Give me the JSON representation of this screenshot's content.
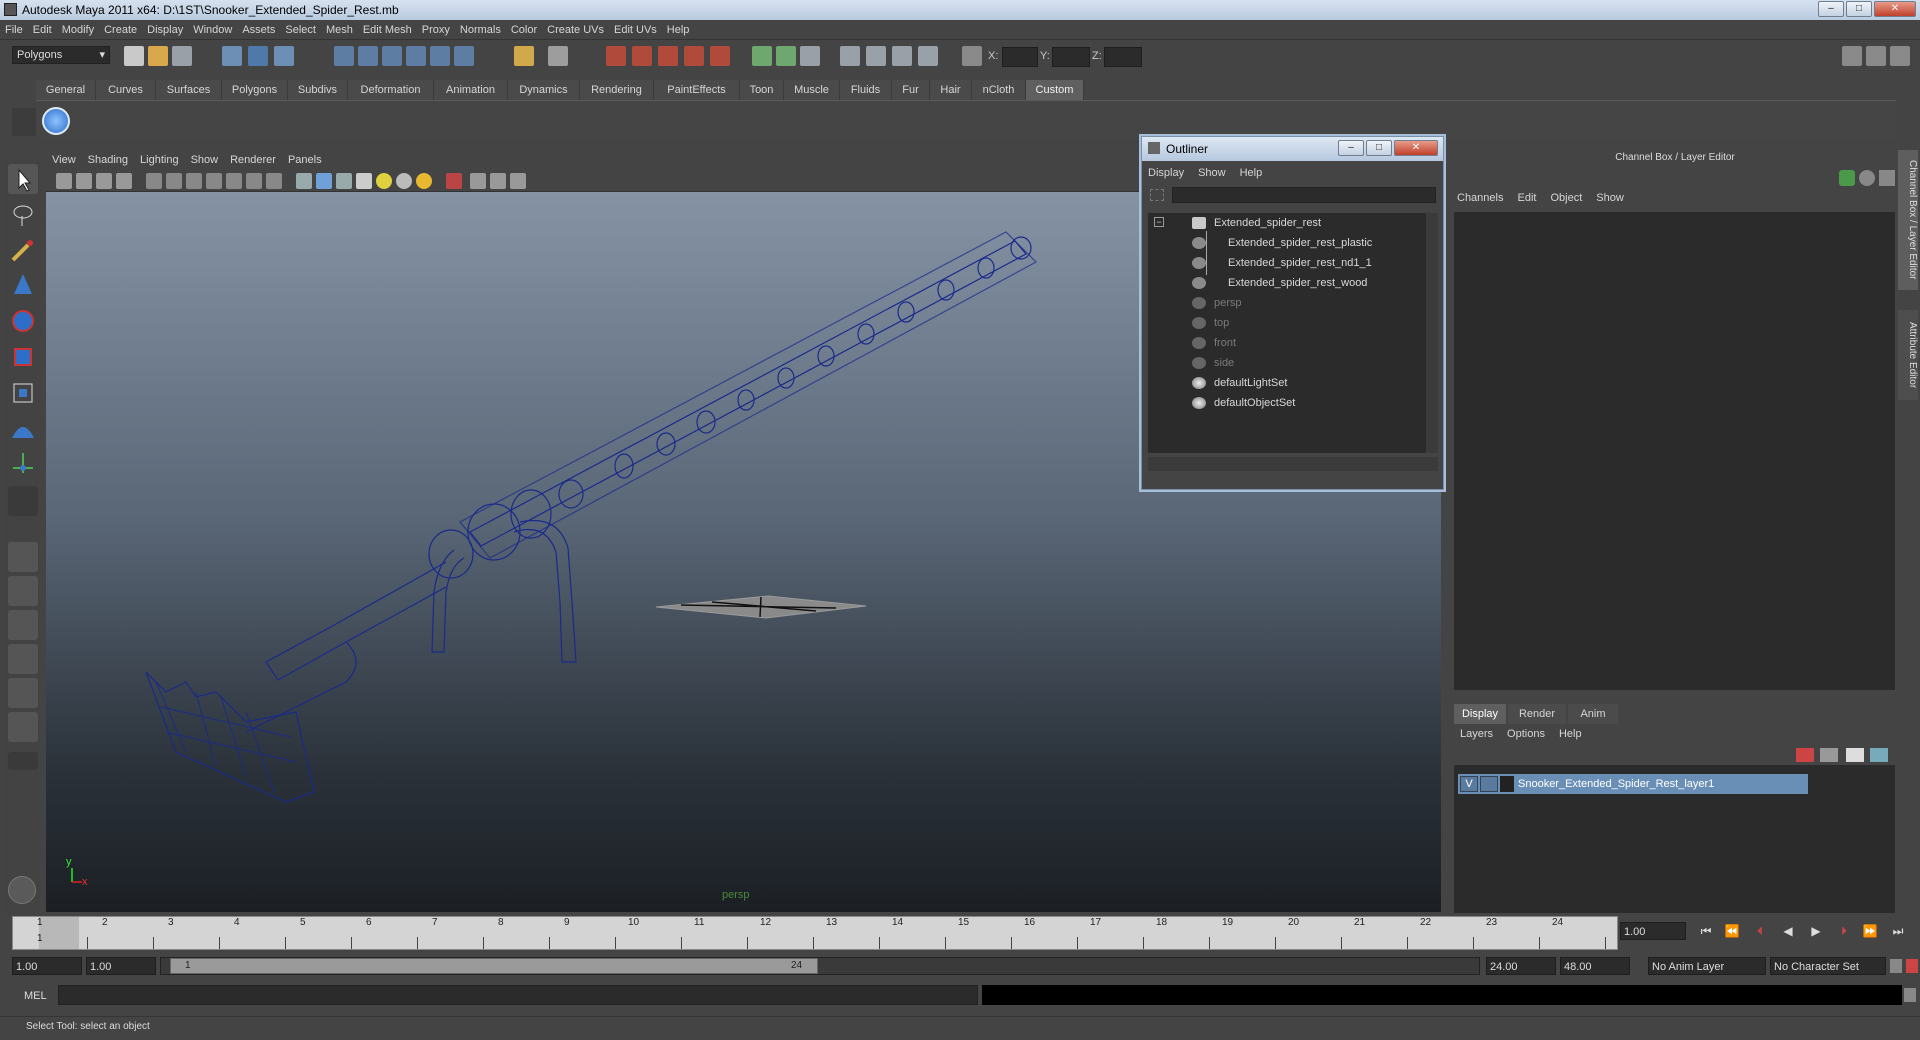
{
  "window": {
    "title": "Autodesk Maya 2011 x64: D:\\1ST\\Snooker_Extended_Spider_Rest.mb",
    "minimize": "–",
    "maximize": "□",
    "close": "✕"
  },
  "menubar": [
    "File",
    "Edit",
    "Modify",
    "Create",
    "Display",
    "Window",
    "Assets",
    "Select",
    "Mesh",
    "Edit Mesh",
    "Proxy",
    "Normals",
    "Color",
    "Create UVs",
    "Edit UVs",
    "Help"
  ],
  "statusline": {
    "mode": "Polygons",
    "x_label": "X:",
    "y_label": "Y:",
    "z_label": "Z:"
  },
  "shelf_tabs": [
    "General",
    "Curves",
    "Surfaces",
    "Polygons",
    "Subdivs",
    "Deformation",
    "Animation",
    "Dynamics",
    "Rendering",
    "PaintEffects",
    "Toon",
    "Muscle",
    "Fluids",
    "Fur",
    "Hair",
    "nCloth",
    "Custom"
  ],
  "shelf_active": "Custom",
  "viewport": {
    "menu": [
      "View",
      "Shading",
      "Lighting",
      "Show",
      "Renderer",
      "Panels"
    ],
    "camera_label": "persp",
    "axis_y": "y",
    "axis_x": "x",
    "wire_color": "#1a2a8a"
  },
  "outliner": {
    "title": "Outliner",
    "menu": [
      "Display",
      "Show",
      "Help"
    ],
    "items": [
      {
        "label": "Extended_spider_rest",
        "level": 0,
        "dim": false
      },
      {
        "label": "Extended_spider_rest_plastic",
        "level": 1,
        "dim": false
      },
      {
        "label": "Extended_spider_rest_nd1_1",
        "level": 1,
        "dim": false
      },
      {
        "label": "Extended_spider_rest_wood",
        "level": 1,
        "dim": false
      },
      {
        "label": "persp",
        "level": 0,
        "dim": true
      },
      {
        "label": "top",
        "level": 0,
        "dim": true
      },
      {
        "label": "front",
        "level": 0,
        "dim": true
      },
      {
        "label": "side",
        "level": 0,
        "dim": true
      },
      {
        "label": "defaultLightSet",
        "level": 0,
        "dim": false
      },
      {
        "label": "defaultObjectSet",
        "level": 0,
        "dim": false
      }
    ]
  },
  "channel_box": {
    "header": "Channel Box / Layer Editor",
    "menu": [
      "Channels",
      "Edit",
      "Object",
      "Show"
    ],
    "layer_tabs": [
      "Display",
      "Render",
      "Anim"
    ],
    "layer_menu": [
      "Layers",
      "Options",
      "Help"
    ],
    "layer": {
      "visible": "V",
      "name": "Snooker_Extended_Spider_Rest_layer1"
    }
  },
  "side_tabs": [
    "Channel Box / Layer Editor",
    "Attribute Editor"
  ],
  "timeslider": {
    "ticks": [
      "1",
      "2",
      "3",
      "4",
      "5",
      "6",
      "7",
      "8",
      "9",
      "10",
      "11",
      "12",
      "13",
      "14",
      "15",
      "16",
      "17",
      "18",
      "19",
      "20",
      "21",
      "22",
      "23",
      "24"
    ],
    "current_frame": "1",
    "current_frame_field": "1.00"
  },
  "range": {
    "start": "1.00",
    "start_inner": "1.00",
    "handle_start": "1",
    "handle_end": "24",
    "end_inner": "24.00",
    "end": "48.00",
    "anim_layer": "No Anim Layer",
    "char_set": "No Character Set"
  },
  "command": {
    "label": "MEL"
  },
  "helpline": "Select Tool: select an object"
}
